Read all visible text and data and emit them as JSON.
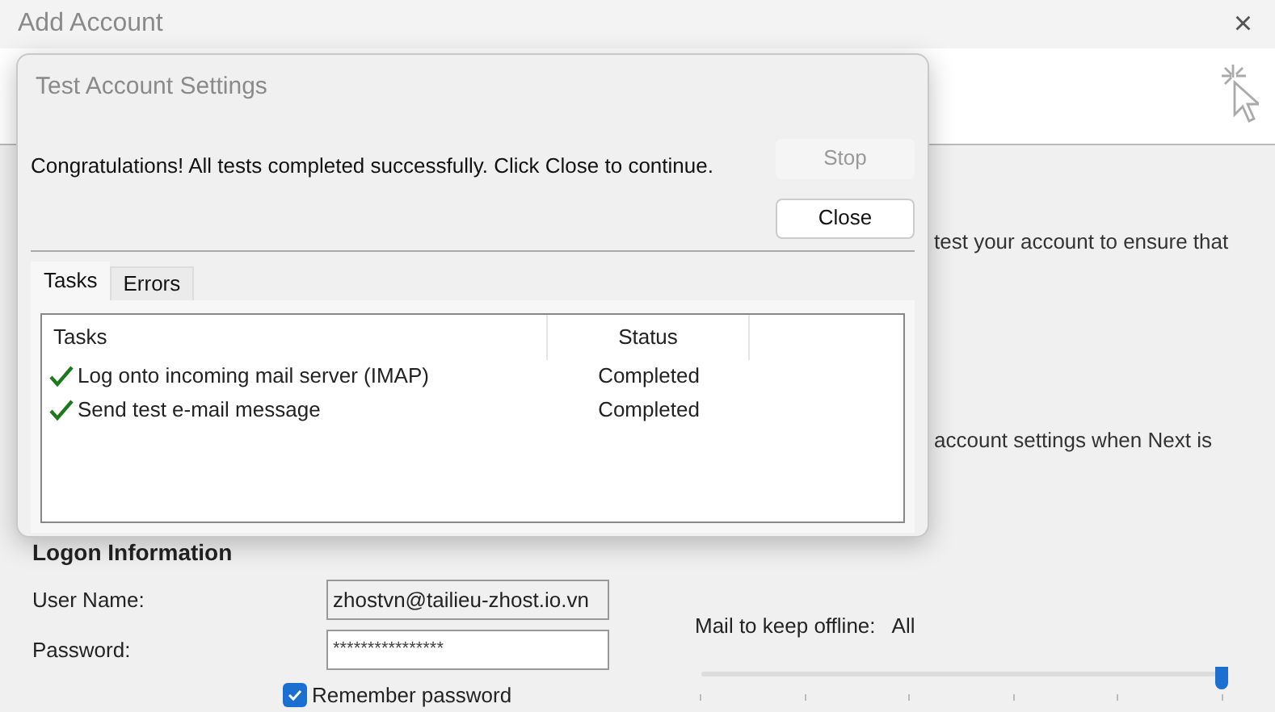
{
  "window": {
    "title": "Add Account",
    "close": "×"
  },
  "background_text": [
    "test your account to ensure that",
    "account settings when Next is"
  ],
  "logon_information": {
    "heading": "Logon Information",
    "user_name": {
      "label": "User Name:",
      "value": "zhostvn@tailieu-zhost.io.vn"
    },
    "password": {
      "label": "Password:",
      "value": "****************"
    },
    "remember_password": {
      "label": "Remember password",
      "checked": true
    }
  },
  "offline": {
    "label": "Mail to keep offline:",
    "value": "All",
    "level": 1
  },
  "dialog": {
    "title": "Test Account Settings",
    "message": "Congratulations! All tests completed successfully. Click Close to continue.",
    "buttons": [
      {
        "label": "Stop",
        "disabled": true
      },
      {
        "label": "Close",
        "disabled": false
      }
    ],
    "tabs": [
      {
        "label": "Tasks",
        "selected": true
      },
      {
        "label": "Errors",
        "selected": false
      }
    ],
    "table": {
      "columns": [
        "Tasks",
        "Status"
      ],
      "rows": [
        {
          "task": "Log onto incoming mail server (IMAP)",
          "status": "Completed",
          "done": true
        },
        {
          "task": "Send test e-mail message",
          "status": "Completed",
          "done": true
        }
      ]
    }
  }
}
